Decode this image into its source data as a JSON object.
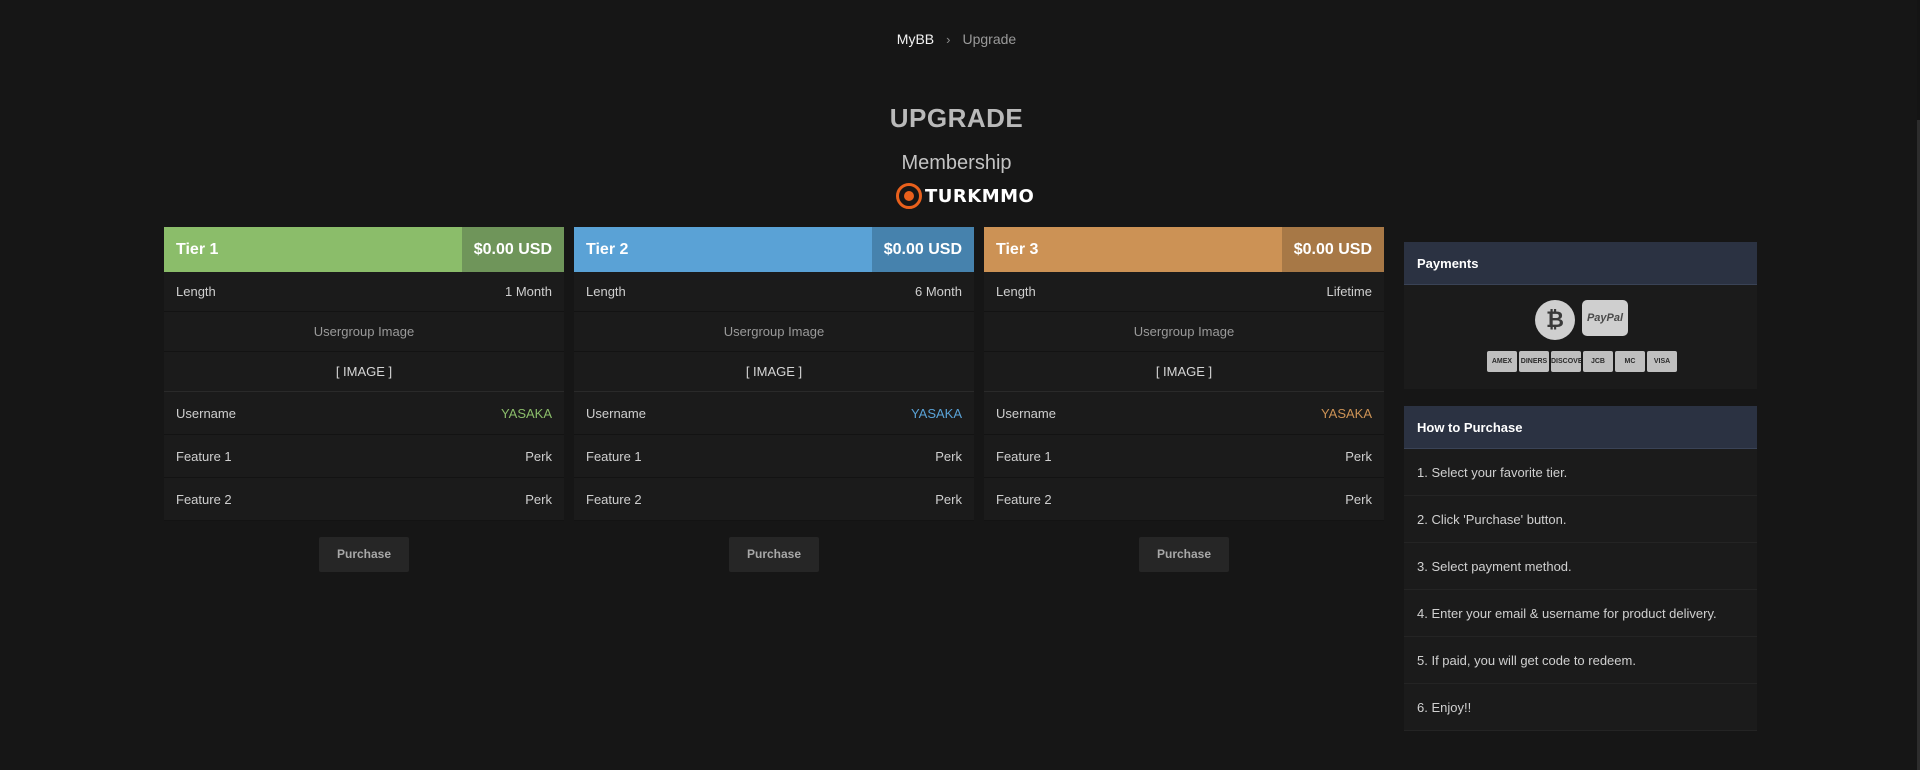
{
  "breadcrumb": {
    "home": "MyBB",
    "separator": "›",
    "current": "Upgrade"
  },
  "page": {
    "title": "UPGRADE",
    "subtitle": "Membership",
    "logo_text": "TURKMMO"
  },
  "tiers": [
    {
      "name": "Tier 1",
      "price": "$0.00 USD",
      "color": "#8bbd6a",
      "price_color": "#6f955a",
      "length_label": "Length",
      "length": "1 Month",
      "usergroup_label": "Usergroup Image",
      "image_placeholder": "[ IMAGE ]",
      "username_label": "Username",
      "username": "YASAKA",
      "username_color": "#8bbd6a",
      "feature1_label": "Feature 1",
      "feature1": "Perk",
      "feature2_label": "Feature 2",
      "feature2": "Perk",
      "button": "Purchase"
    },
    {
      "name": "Tier 2",
      "price": "$0.00 USD",
      "color": "#5aa2d6",
      "price_color": "#4682ad",
      "length_label": "Length",
      "length": "6 Month",
      "usergroup_label": "Usergroup Image",
      "image_placeholder": "[ IMAGE ]",
      "username_label": "Username",
      "username": "YASAKA",
      "username_color": "#5aa2d6",
      "feature1_label": "Feature 1",
      "feature1": "Perk",
      "feature2_label": "Feature 2",
      "feature2": "Perk",
      "button": "Purchase"
    },
    {
      "name": "Tier 3",
      "price": "$0.00 USD",
      "color": "#cc9255",
      "price_color": "#a77846",
      "length_label": "Length",
      "length": "Lifetime",
      "usergroup_label": "Usergroup Image",
      "image_placeholder": "[ IMAGE ]",
      "username_label": "Username",
      "username": "YASAKA",
      "username_color": "#cc9255",
      "feature1_label": "Feature 1",
      "feature1": "Perk",
      "feature2_label": "Feature 2",
      "feature2": "Perk",
      "button": "Purchase"
    }
  ],
  "payments": {
    "title": "Payments",
    "crypto_icon": "bitcoin-icon",
    "paypal_label": "PayPal",
    "cards": [
      "AMEX",
      "DINERS",
      "DISCOVER",
      "JCB",
      "MC",
      "VISA"
    ]
  },
  "how_to": {
    "title": "How to Purchase",
    "steps": [
      "1. Select your favorite tier.",
      "2. Click 'Purchase' button.",
      "3. Select payment method.",
      "4. Enter your email & username for product delivery.",
      "5. If paid, you will get code to redeem.",
      "6. Enjoy!!"
    ]
  }
}
